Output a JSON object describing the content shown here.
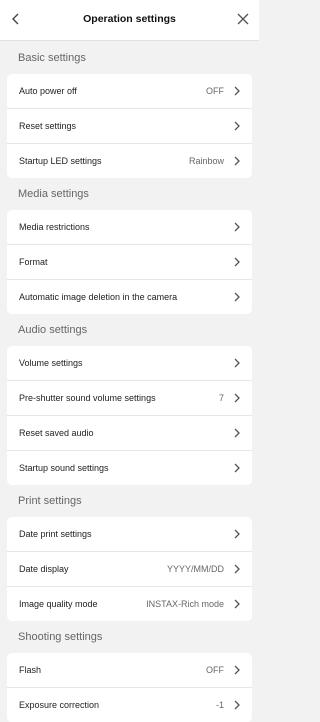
{
  "header": {
    "title": "Operation settings"
  },
  "sections": [
    {
      "title": "Basic settings",
      "rows": [
        {
          "label": "Auto power off",
          "value": "OFF"
        },
        {
          "label": "Reset settings",
          "value": ""
        },
        {
          "label": "Startup LED settings",
          "value": "Rainbow"
        }
      ]
    },
    {
      "title": "Media settings",
      "rows": [
        {
          "label": "Media restrictions",
          "value": ""
        },
        {
          "label": "Format",
          "value": ""
        },
        {
          "label": "Automatic image deletion in the camera",
          "value": ""
        }
      ]
    },
    {
      "title": "Audio settings",
      "rows": [
        {
          "label": "Volume settings",
          "value": ""
        },
        {
          "label": "Pre-shutter sound volume settings",
          "value": "7"
        },
        {
          "label": "Reset saved audio",
          "value": ""
        },
        {
          "label": "Startup sound settings",
          "value": ""
        }
      ]
    },
    {
      "title": "Print settings",
      "rows": [
        {
          "label": "Date print settings",
          "value": ""
        },
        {
          "label": "Date display",
          "value": "YYYY/MM/DD"
        },
        {
          "label": "Image quality mode",
          "value": "INSTAX-Rich mode"
        }
      ]
    },
    {
      "title": "Shooting settings",
      "rows": [
        {
          "label": "Flash",
          "value": "OFF"
        },
        {
          "label": "Exposure correction",
          "value": "-1"
        }
      ]
    }
  ]
}
